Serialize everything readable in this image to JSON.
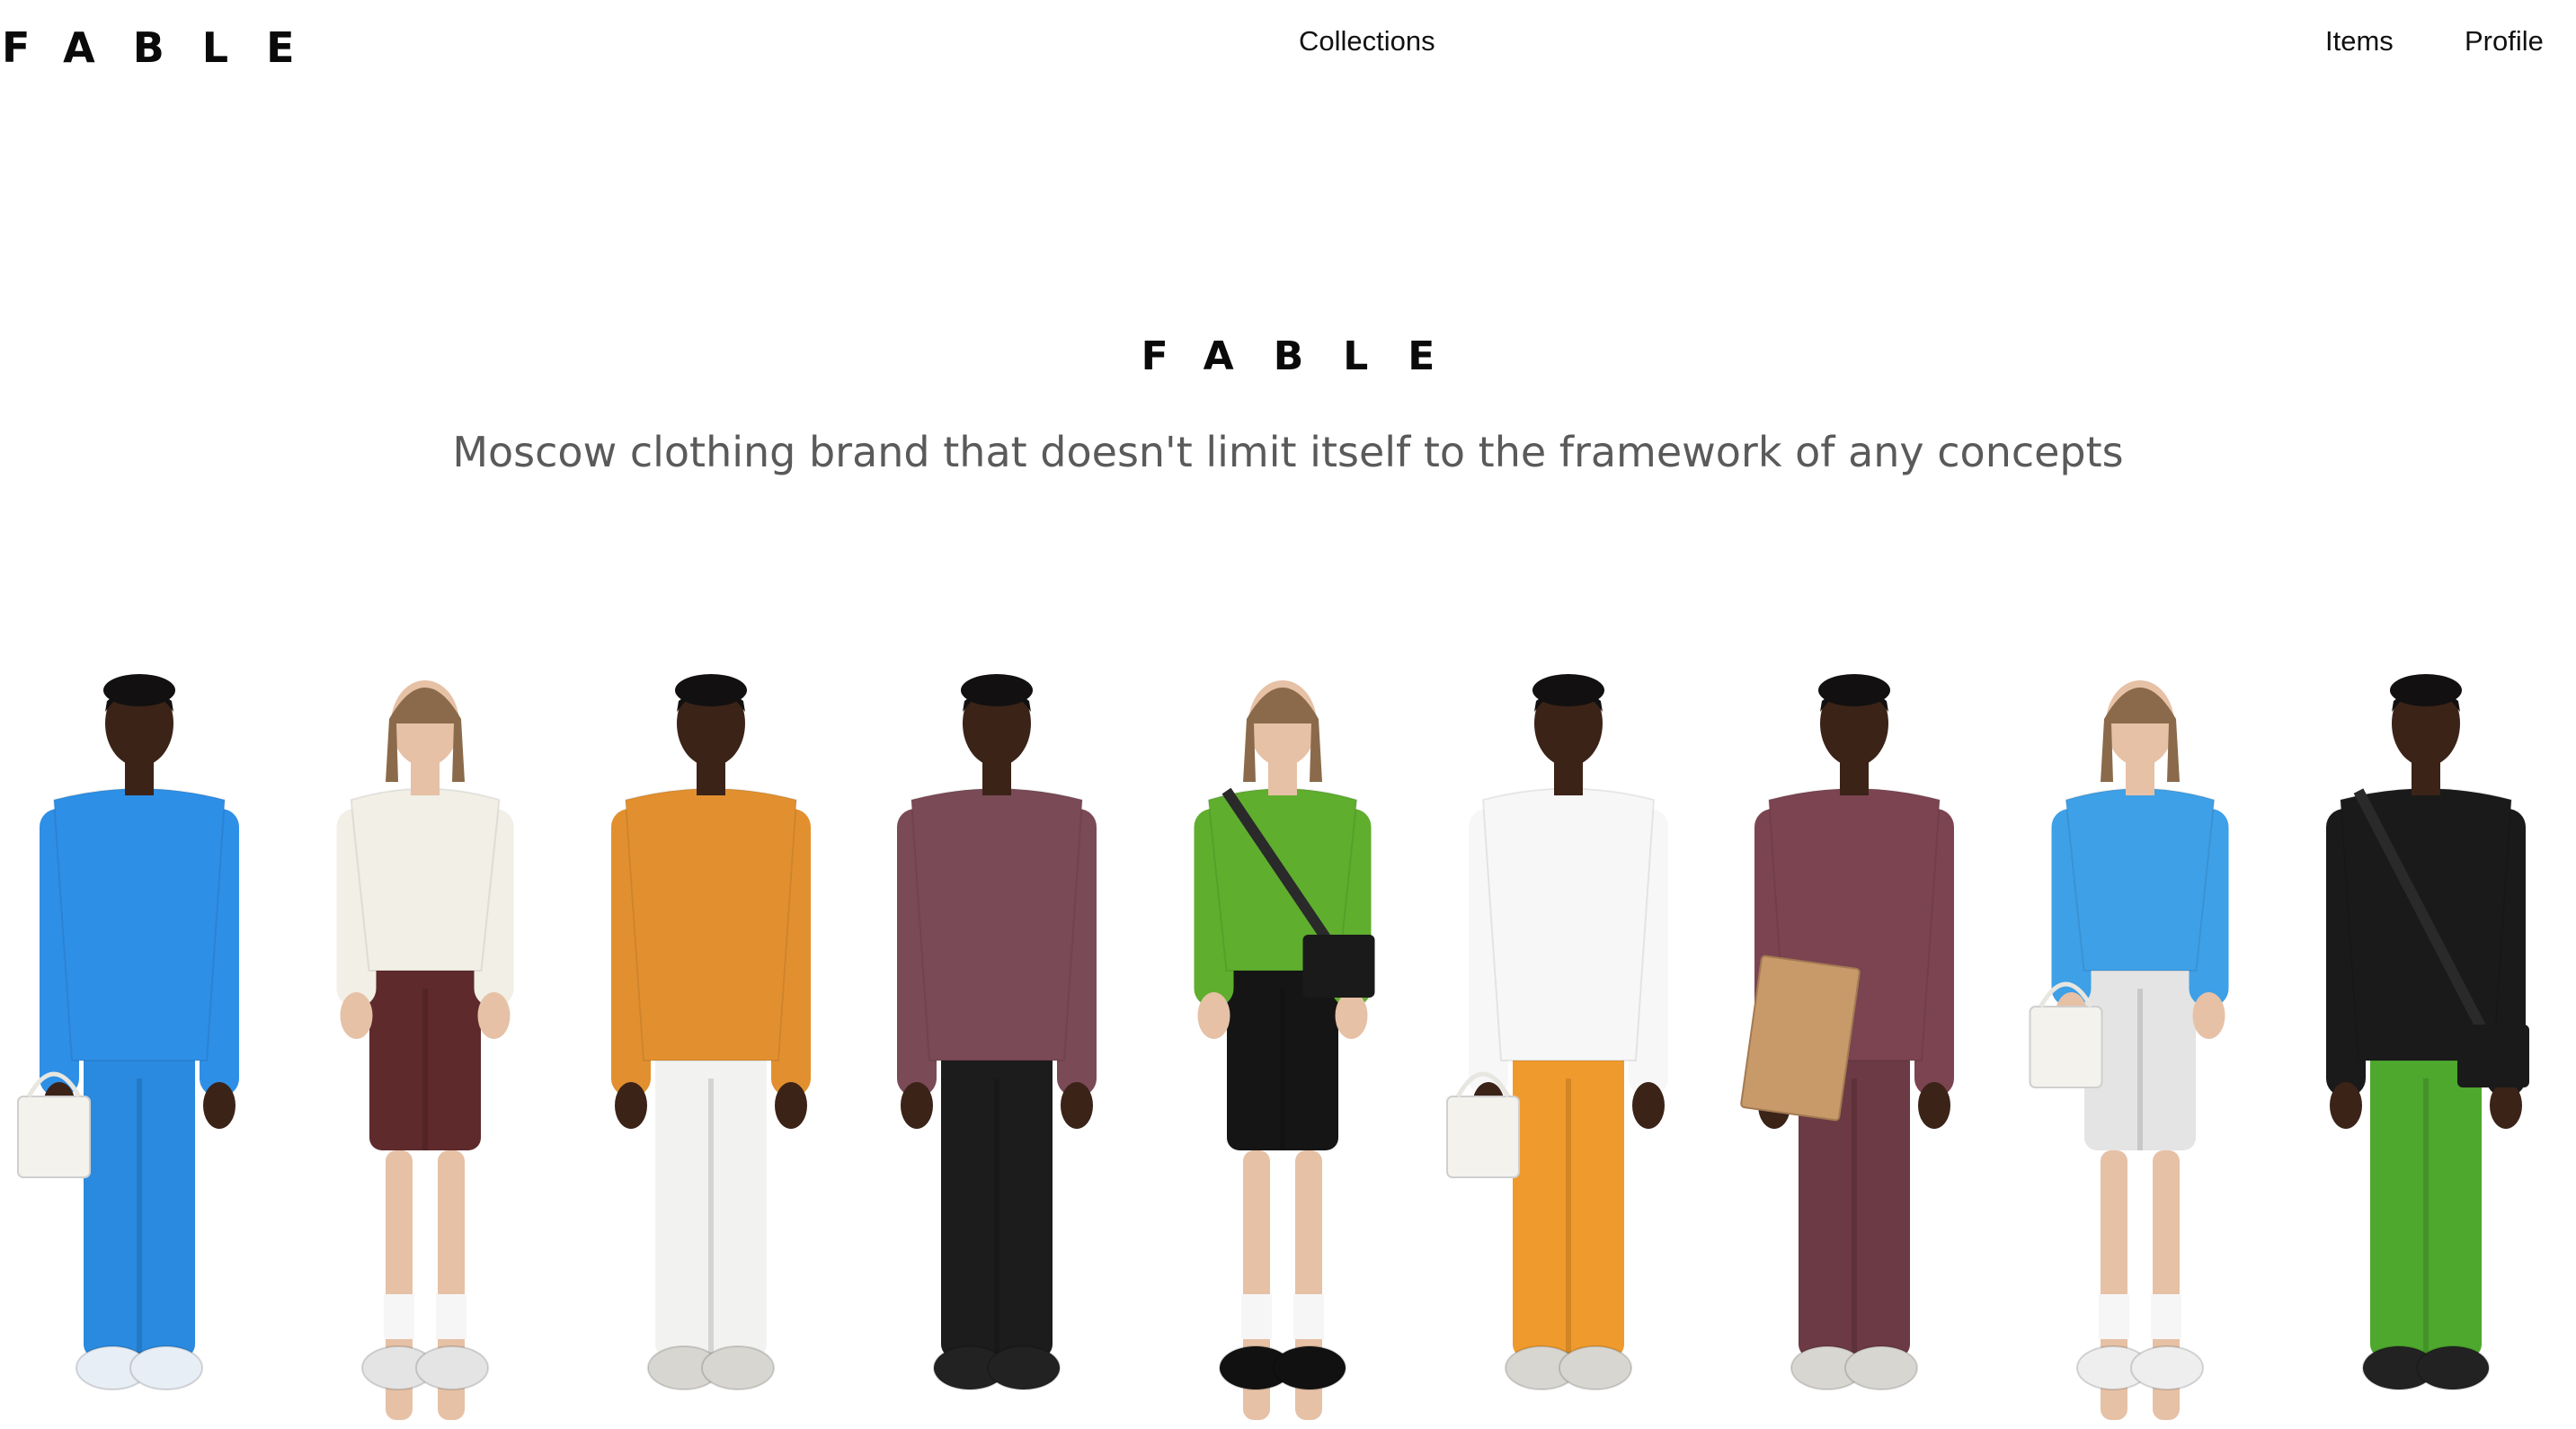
{
  "brand": {
    "logo_text": "FABLE"
  },
  "nav": {
    "collections": "Collections",
    "items": "Items",
    "profile": "Profile"
  },
  "hero": {
    "title": "FABLE",
    "subtitle": "Moscow clothing brand that doesn't limit itself to the framework of any concepts"
  },
  "lineup": {
    "models": [
      {
        "name": "model-1",
        "gender": "m",
        "top": "#2e8fe6",
        "bottom": "#2a8ae0",
        "shorts": false,
        "shoes": "#e8eef5",
        "accessory": "tote"
      },
      {
        "name": "model-2",
        "gender": "f",
        "top": "#f1efe6",
        "bottom": "#5e2a2c",
        "shorts": true,
        "shoes": "#e4e4e4",
        "accessory": ""
      },
      {
        "name": "model-3",
        "gender": "m",
        "top": "#e2902f",
        "bottom": "#f2f2f0",
        "shorts": false,
        "shoes": "#d8d6d0",
        "accessory": ""
      },
      {
        "name": "model-4",
        "gender": "m",
        "top": "#7a4a56",
        "bottom": "#1c1c1c",
        "shorts": false,
        "shoes": "#222222",
        "accessory": ""
      },
      {
        "name": "model-5",
        "gender": "f",
        "top": "#5fae2e",
        "bottom": "#151515",
        "shorts": true,
        "shoes": "#111111",
        "accessory": "crossbody"
      },
      {
        "name": "model-6",
        "gender": "m",
        "top": "#f7f7f7",
        "bottom": "#ef9a2c",
        "shorts": false,
        "shoes": "#d8d6d0",
        "accessory": "tote"
      },
      {
        "name": "model-7",
        "gender": "m",
        "top": "#7b4450",
        "bottom": "#6c3a44",
        "shorts": false,
        "shoes": "#d8d6d0",
        "accessory": "box"
      },
      {
        "name": "model-8",
        "gender": "f",
        "top": "#3ea0e6",
        "bottom": "#e4e4e4",
        "shorts": true,
        "shoes": "#eeeeee",
        "accessory": "tote"
      },
      {
        "name": "model-9",
        "gender": "m",
        "top": "#1a1a1a",
        "bottom": "#4ea82e",
        "shorts": false,
        "shoes": "#222222",
        "accessory": "crossbody"
      }
    ],
    "box_label": "FABLE"
  }
}
